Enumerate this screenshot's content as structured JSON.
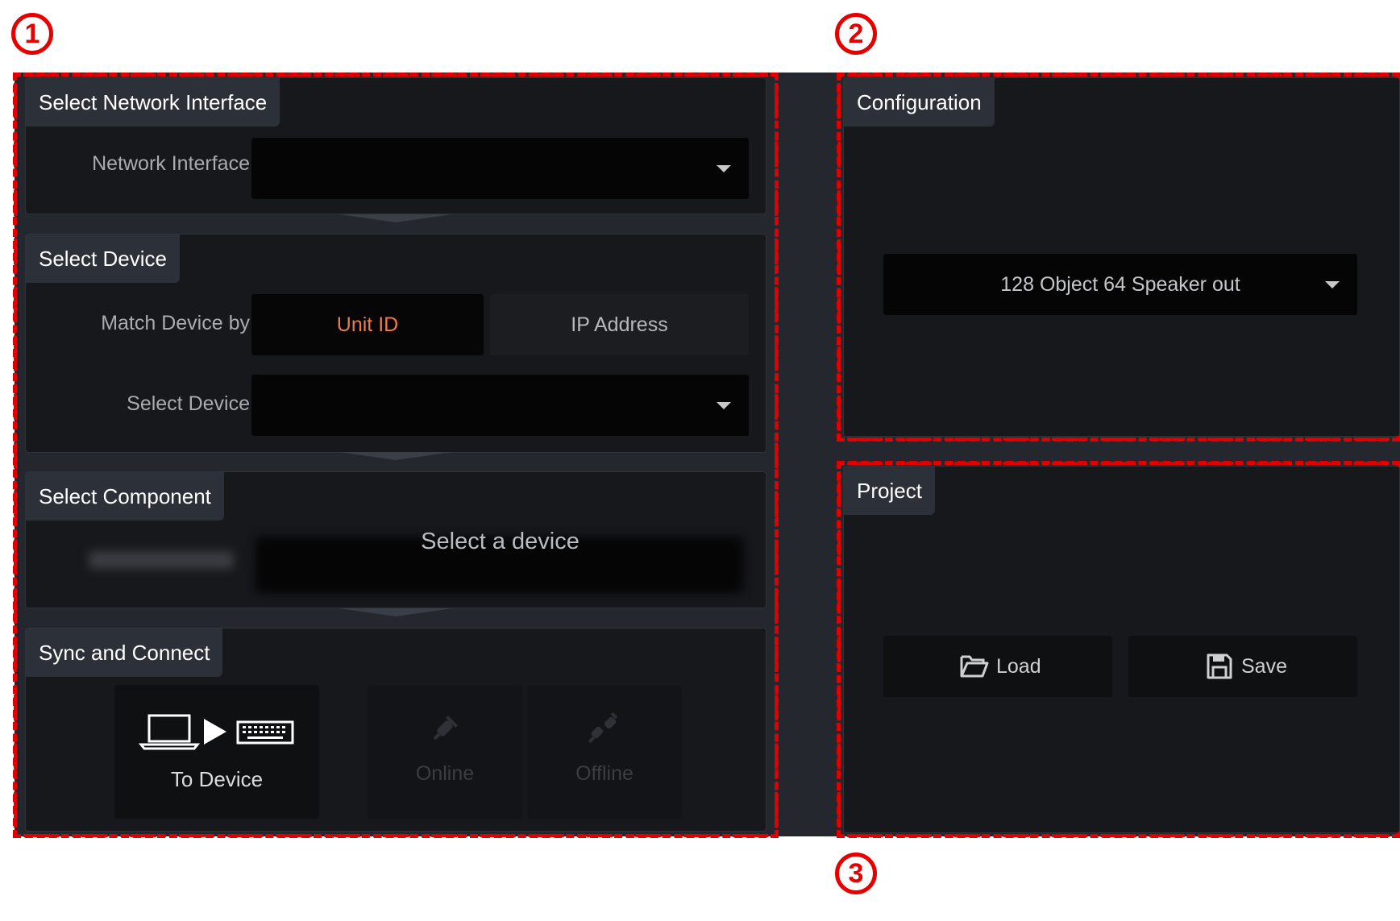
{
  "callouts": [
    "1",
    "2",
    "3"
  ],
  "network_panel": {
    "title": "Select Network Interface",
    "label": "Network Interface",
    "value": ""
  },
  "device_panel": {
    "title": "Select Device",
    "match_label": "Match Device by",
    "match_options": [
      "Unit ID",
      "IP Address"
    ],
    "match_selected": "Unit ID",
    "select_label": "Select Device",
    "select_value": ""
  },
  "component_panel": {
    "title": "Select Component",
    "placeholder": "Select a device"
  },
  "sync_panel": {
    "title": "Sync and Connect",
    "buttons": [
      {
        "label": "To Device",
        "icon": "laptop-to-device-icon",
        "enabled": true
      },
      {
        "label": "Online",
        "icon": "plug-connect-icon",
        "enabled": false
      },
      {
        "label": "Offline",
        "icon": "plug-disconnect-icon",
        "enabled": false
      }
    ]
  },
  "config_panel": {
    "title": "Configuration",
    "selected": "128 Object 64 Speaker out"
  },
  "project_panel": {
    "title": "Project",
    "load_label": "Load",
    "save_label": "Save"
  },
  "colors": {
    "accent": "#f07a4a",
    "annotation": "#e60000",
    "panel_bg": "#16181b",
    "app_bg": "#24272d"
  }
}
